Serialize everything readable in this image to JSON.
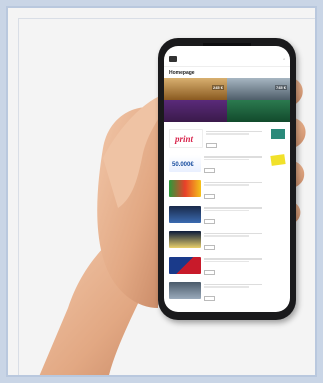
{
  "site": {
    "logo_text": "",
    "nav": [
      "",
      "",
      "",
      "",
      "",
      ""
    ],
    "page_title": "Homepage"
  },
  "hero": {
    "price_left": "245 €",
    "price_right": "745 €",
    "promo_left": "",
    "promo_right": ""
  },
  "list": {
    "section_label": "",
    "items": [
      {
        "title": ""
      },
      {
        "title": ""
      },
      {
        "title": ""
      },
      {
        "title": ""
      },
      {
        "title": ""
      },
      {
        "title": ""
      },
      {
        "title": ""
      }
    ]
  }
}
